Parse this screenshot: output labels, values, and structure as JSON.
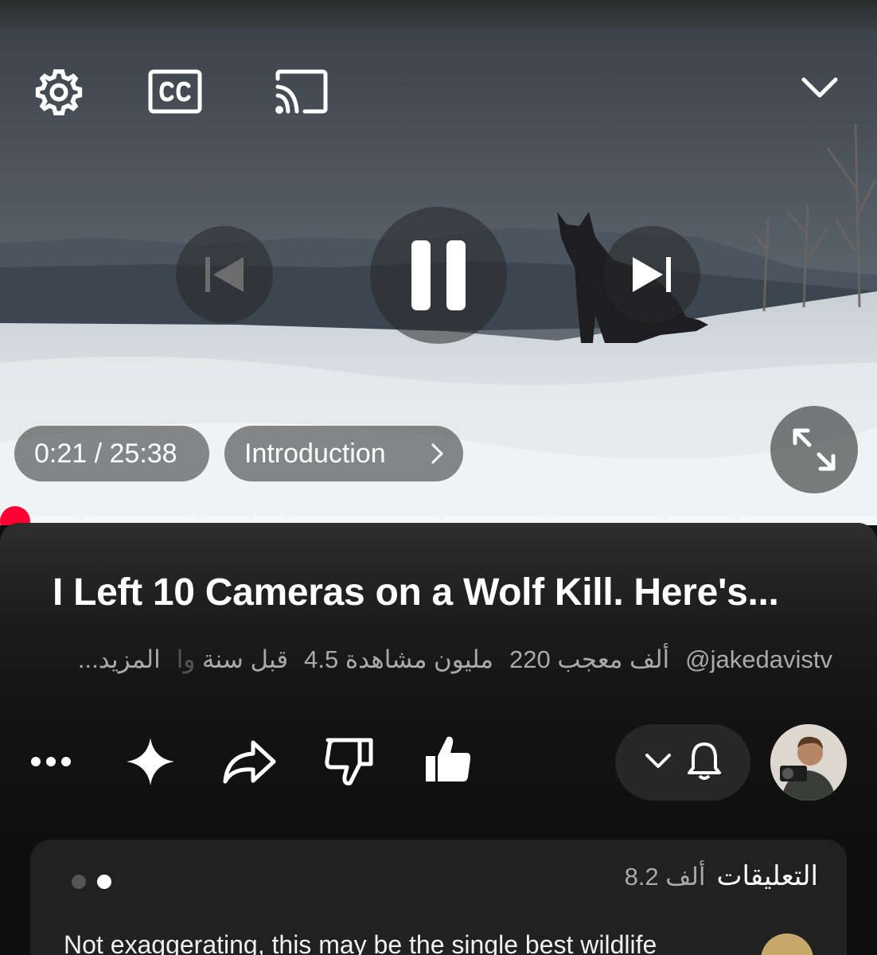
{
  "player": {
    "time": "0:21 / 25:38",
    "chapter": "Introduction",
    "progress_fraction": 0.014,
    "icons": {
      "settings": "gear-icon",
      "captions": "cc-icon",
      "cast": "cast-icon",
      "minimize": "chevron-down-icon",
      "previous": "skip-previous-icon",
      "play_pause": "pause-icon",
      "next": "skip-next-icon",
      "fullscreen": "fullscreen-icon"
    },
    "accent_color": "#ff0033"
  },
  "video": {
    "title": "I Left 10 Cameras on a Wolf Kill. Here's...",
    "channel": "@jakedavistv",
    "likes": "220 ألف معجب",
    "views": "4.5 مليون مشاهدة",
    "age": "قبل سنة",
    "age_tail": "وا",
    "more": "...المزيد"
  },
  "actions": {
    "icons": [
      "more-icon",
      "sparkle-icon",
      "share-icon",
      "dislike-icon",
      "like-icon",
      "chevron-down-icon",
      "bell-icon",
      "avatar"
    ]
  },
  "comments": {
    "label": "التعليقات",
    "count": "8.2 ألف",
    "first_comment": "Not exaggerating, this may be the single best wildlife"
  }
}
